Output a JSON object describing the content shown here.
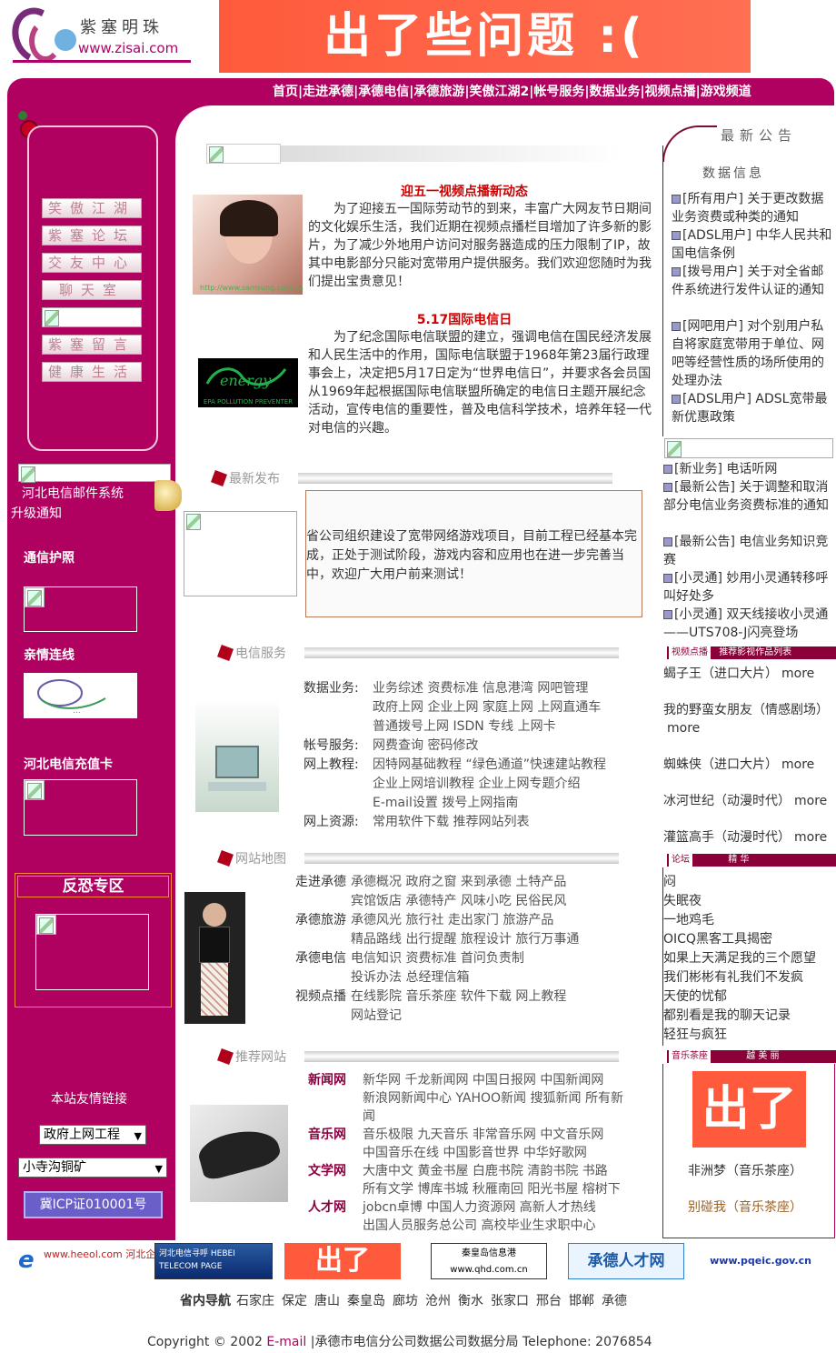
{
  "header": {
    "logo_cn": "紫塞明珠",
    "logo_url": "www.zisai.com",
    "banner": "出了些问题 :("
  },
  "topnav": [
    "首页",
    "走进承德",
    "承德电信",
    "承德旅游",
    "笑傲江湖2",
    "帐号服务",
    "数据业务",
    "视频点播",
    "游戏频道"
  ],
  "left": {
    "menu": [
      "笑傲江湖",
      "紫塞论坛",
      "交友中心",
      "聊天室",
      "紫塞留言",
      "健康生活"
    ],
    "mail_title": "河北电信邮件系统",
    "mail_sub": "升级通知",
    "passport": "通信护照",
    "qinqing": "亲情连线",
    "chongzhi": "河北电信充值卡",
    "antiterror": "反恐专区",
    "friend_links": "本站友情链接",
    "select1": "政府上网工程",
    "select2": "小寺沟铜矿",
    "icp": "冀ICP证010001号"
  },
  "news": [
    {
      "title": "迎五一视频点播新动态",
      "body": "为了迎接五一国际劳动节的到来，丰富广大网友节日期间的文化娱乐生活，我们近期在视频点播栏目增加了许多新的影片，为了减少外地用户访问对服务器造成的压力限制了IP，故其中电影部分只能对宽带用户提供服务。我们欢迎您随时为我们提出宝贵意见！",
      "img_caption": "http://www.samsung.com.cn"
    },
    {
      "title": "5.17国际电信日",
      "body": "为了纪念国际电信联盟的建立，强调电信在国民经济发展和人民生活中的作用，国际电信联盟于1968年第23届行政理事会上，决定把5月17日定为“世界电信日”，并要求各会员国从1969年起根据国际电信联盟所确定的电信日主题开展纪念活动，宣传电信的重要性，普及电信科学技术，培养年轻一代对电信的兴趣。",
      "img_caption": "EPA POLLUTION PREVENTER"
    }
  ],
  "sections": {
    "latest": "最新发布",
    "latest_text": "省公司组织建设了宽带网络游戏项目，目前工程已经基本完成，正处于测试阶段，游戏内容和应用也在进一步完善当中，欢迎广大用户前来测试！",
    "telecom": "电信服务",
    "sitemap": "网站地图",
    "recommend": "推荐网站"
  },
  "telecom_rows": [
    {
      "label": "数据业务:",
      "lines": [
        "业务综述 资费标准 信息港湾 网吧管理",
        "政府上网 企业上网 家庭上网 上网直通车",
        "普通拨号上网 ISDN 专线 上网卡"
      ]
    },
    {
      "label": "帐号服务:",
      "lines": [
        "网费查询 密码修改"
      ]
    },
    {
      "label": "网上教程:",
      "lines": [
        "因特网基础教程 “绿色通道”快速建站教程",
        "企业上网培训教程 企业上网专题介绍",
        "E-mail设置 拨号上网指南"
      ]
    },
    {
      "label": "网上资源:",
      "lines": [
        "常用软件下载 推荐网站列表"
      ]
    }
  ],
  "sitemap_rows": [
    {
      "label": "走进承德",
      "lines": [
        "承德概况 政府之窗 来到承德 土特产品",
        "宾馆饭店 承德特产 风味小吃 民俗民风"
      ]
    },
    {
      "label": "承德旅游",
      "lines": [
        "承德风光 旅行社 走出家门 旅游产品",
        "精品路线 出行提醒 旅程设计 旅行万事通"
      ]
    },
    {
      "label": "承德电信",
      "lines": [
        "电信知识 资费标准 首问负责制",
        "投诉办法 总经理信箱"
      ]
    },
    {
      "label": "视频点播",
      "lines": [
        "在线影院 音乐茶座 软件下载 网上教程",
        "网站登记"
      ]
    }
  ],
  "recommend_rows": [
    {
      "label": "新闻网",
      "lines": [
        "新华网 千龙新闻网 中国日报网 中国新闻网",
        "新浪网新闻中心 YAHOO新闻 搜狐新闻 所有新",
        "闻"
      ]
    },
    {
      "label": "音乐网",
      "lines": [
        "音乐极限 九天音乐 非常音乐网 中文音乐网",
        "中国音乐在线 中国影音世界 中华好歌网"
      ]
    },
    {
      "label": "文学网",
      "lines": [
        "大唐中文 黄金书屋 白鹿书院 清韵书院 书路",
        "所有文学 博库书城 秋雁南回 阳光书屋 榕树下"
      ]
    },
    {
      "label": "人才网",
      "lines": [
        "jobcn卓博 中国人力资源网 高新人才热线",
        "出国人员服务总公司 高校毕业生求职中心"
      ]
    }
  ],
  "right": {
    "header": "最新公告",
    "subheader": "数据信息",
    "notices": [
      "[所有用户] 关于更改数据业务资费或种类的通知",
      "[ADSL用户] 中华人民共和国电信条例",
      "[拨号用户] 关于对全省邮件系统进行发件认证的通知",
      "[网吧用户] 对个别用户私自将家庭宽带用于单位、网吧等经营性质的场所使用的处理办法",
      "[ADSL用户] ADSL宽带最新优惠政策"
    ],
    "notices2": [
      "[新业务] 电话听网",
      "[最新公告] 关于调整和取消部分电信业务资费标准的通知",
      "[最新公告] 电信业务知识竞赛",
      "[小灵通] 妙用小灵通转移呼叫好处多",
      "[小灵通] 双天线接收小灵通——UTS708-J闪亮登场"
    ],
    "strip1_a": "视频点播",
    "strip1_b": "推荐影视作品列表",
    "movies": [
      {
        "title": "蝎子王（进口大片）",
        "more": "more"
      },
      {
        "title": "我的野蛮女朋友（情感剧场）",
        "more": "more"
      },
      {
        "title": "蜘蛛侠（进口大片）",
        "more": "more"
      },
      {
        "title": "冰河世纪（动漫时代）",
        "more": "more"
      },
      {
        "title": "灌篮高手（动漫时代）",
        "more": "more"
      }
    ],
    "strip2_a": "论坛",
    "strip2_b": "精 华",
    "essence": [
      "闷",
      "失眠夜",
      "一地鸡毛",
      "OICQ黑客工具揭密",
      "如果上天满足我的三个愿望",
      "我们彬彬有礼我们不发疯",
      "天使的忧郁",
      "都别看是我的聊天记录",
      "轻狂与疯狂"
    ],
    "strip3_a": "音乐茶座",
    "strip3_b": "越 美 丽",
    "music_banner": "出了",
    "music": [
      "非洲梦（音乐茶座）",
      "别碰我（音乐茶座）"
    ]
  },
  "bottom_logos": [
    "www.heeol.com 河北企业在线",
    "河北电信寻呼 HEBEI TELECOM PAGE",
    "出了",
    "秦皇岛信息港 www.qhd.com.cn",
    "承德人才网",
    "www.pqeic.gov.cn"
  ],
  "footer": {
    "nav_label": "省内导航",
    "cities": [
      "石家庄",
      "保定",
      "唐山",
      "秦皇岛",
      "廊坊",
      "沧州",
      "衡水",
      "张家口",
      "邢台",
      "邯郸",
      "承德"
    ],
    "copyright_pre": "Copyright © 2002",
    "email": "E-mail",
    "copyright_post": "|承德市电信分公司数据公司数据分局 Telephone: 2076854"
  },
  "colors": {
    "primary": "#b00060",
    "accent": "#cc0000"
  }
}
